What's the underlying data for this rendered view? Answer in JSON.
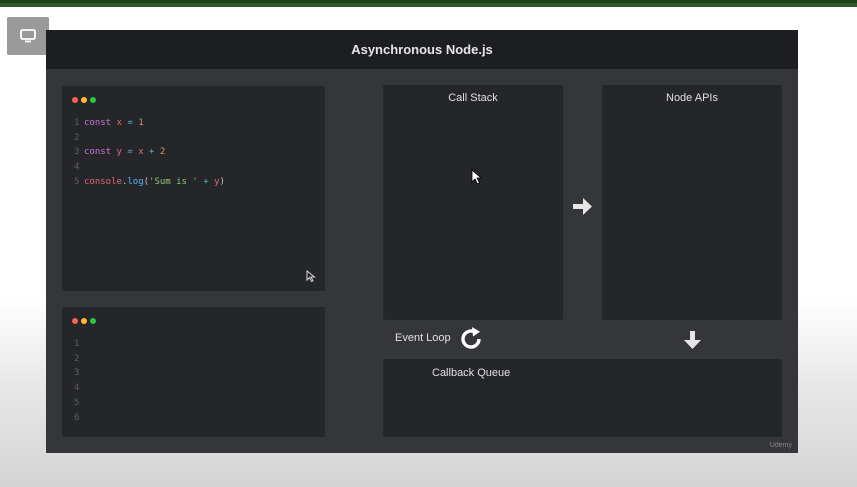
{
  "slide": {
    "title": "Asynchronous Node.js",
    "watermark": "Udemy"
  },
  "editor": {
    "line_numbers": [
      "1",
      "2",
      "3",
      "4",
      "5"
    ],
    "lines": [
      [
        {
          "t": "const",
          "c": "kw"
        },
        {
          "t": " x ",
          "c": "id"
        },
        {
          "t": "=",
          "c": "op"
        },
        {
          "t": " 1",
          "c": "num"
        }
      ],
      [],
      [
        {
          "t": "const",
          "c": "kw"
        },
        {
          "t": " y ",
          "c": "id"
        },
        {
          "t": "=",
          "c": "op"
        },
        {
          "t": " x ",
          "c": "id"
        },
        {
          "t": "+",
          "c": "op"
        },
        {
          "t": " 2",
          "c": "num"
        }
      ],
      [],
      [
        {
          "t": "console",
          "c": "id"
        },
        {
          "t": ".",
          "c": "plain"
        },
        {
          "t": "log",
          "c": "fn"
        },
        {
          "t": "(",
          "c": "plain"
        },
        {
          "t": "'Sum is '",
          "c": "str"
        },
        {
          "t": " + ",
          "c": "op"
        },
        {
          "t": "y",
          "c": "id"
        },
        {
          "t": ")",
          "c": "plain"
        }
      ]
    ]
  },
  "terminal": {
    "line_numbers": [
      "1",
      "2",
      "3",
      "4",
      "5",
      "6"
    ]
  },
  "panels": {
    "call_stack": "Call Stack",
    "node_apis": "Node APIs",
    "callback_queue": "Callback Queue",
    "event_loop": "Event Loop"
  },
  "colors": {
    "dot_red": "#ff5f56",
    "dot_yellow": "#ffbd2e",
    "dot_green": "#27c93f"
  },
  "icons": {
    "screen_button": "monitor-icon",
    "arrow_right": "arrow-right-icon",
    "arrow_down": "arrow-down-icon",
    "event_loop": "refresh-icon"
  }
}
